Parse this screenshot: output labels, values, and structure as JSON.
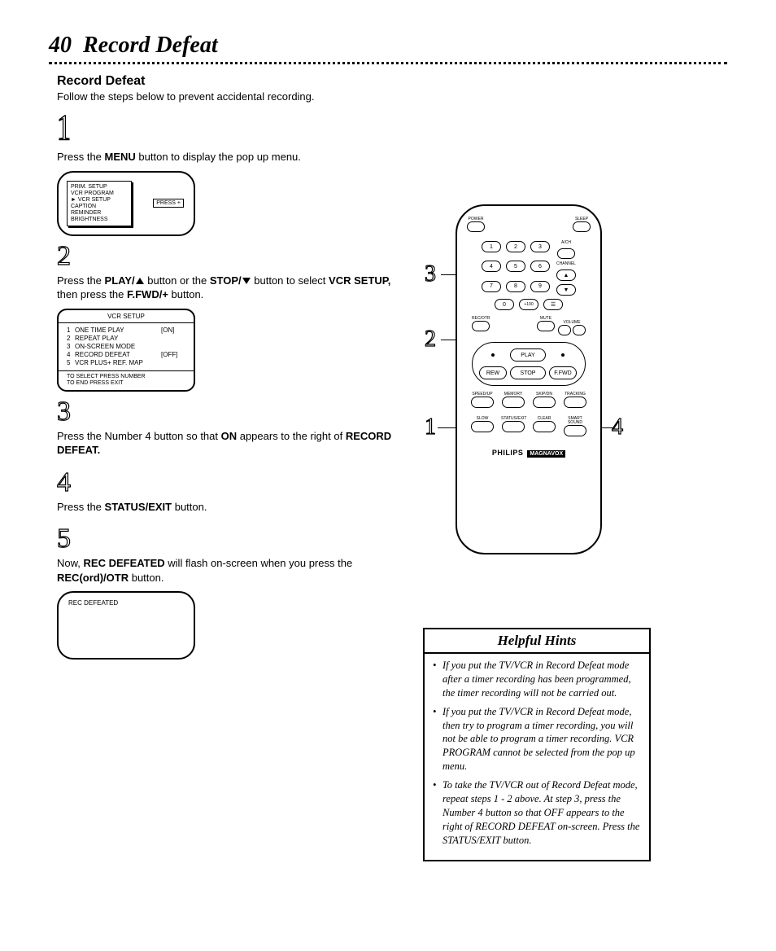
{
  "page": {
    "number": "40",
    "title": "Record Defeat",
    "subheading": "Record Defeat",
    "intro": "Follow the steps below to prevent accidental recording."
  },
  "steps": {
    "s1": {
      "num": "1",
      "text_a": "Press the ",
      "b1": "MENU",
      "text_b": " button to display the pop up menu."
    },
    "s2": {
      "num": "2",
      "t1": "Press the ",
      "b1": "PLAY/",
      "t2": " button or the ",
      "b2": "STOP/",
      "t3": " button to select ",
      "b3": "VCR SETUP,",
      "t4": " then press the ",
      "b4": "F.FWD/+",
      "t5": " button."
    },
    "s3": {
      "num": "3",
      "t1": "Press the Number 4 button so that ",
      "b1": "ON",
      "t2": " appears to the right of ",
      "b2": "RECORD DEFEAT."
    },
    "s4": {
      "num": "4",
      "t1": "Press the ",
      "b1": "STATUS/EXIT",
      "t2": " button."
    },
    "s5": {
      "num": "5",
      "t1": "Now, ",
      "b1": "REC DEFEATED",
      "t2": " will flash on-screen when you press the ",
      "b2": "REC(ord)/OTR",
      "t3": " button."
    }
  },
  "screen1": {
    "items": [
      "PRIM. SETUP",
      "VCR PROGRAM",
      "VCR SETUP",
      "CAPTION",
      "REMINDER",
      "BRIGHTNESS"
    ],
    "pointer_row": 2,
    "button": "PRESS +"
  },
  "screen2": {
    "title": "VCR SETUP",
    "rows": [
      {
        "n": "1",
        "label": "ONE TIME PLAY",
        "val": "[ON]"
      },
      {
        "n": "2",
        "label": "REPEAT PLAY",
        "val": ""
      },
      {
        "n": "3",
        "label": "ON-SCREEN MODE",
        "val": ""
      },
      {
        "n": "4",
        "label": "RECORD DEFEAT",
        "val": "[OFF]"
      },
      {
        "n": "5",
        "label": "VCR PLUS+ REF. MAP",
        "val": ""
      }
    ],
    "foot1": "TO SELECT PRESS NUMBER",
    "foot2": "TO END PRESS EXIT"
  },
  "screen3": {
    "text": "REC DEFEATED"
  },
  "remote": {
    "row1_left": "POWER",
    "row1_right": "SLEEP",
    "nums": [
      "1",
      "2",
      "3",
      "4",
      "5",
      "6",
      "7",
      "8",
      "9",
      "0",
      "+100"
    ],
    "side_top": "A/CH",
    "side_ch": "CHANNEL",
    "vol_left": "MUTE",
    "vol_right": "VOLUME",
    "rec": "REC/OTR",
    "play": "PLAY",
    "rew": "REW",
    "ffwd": "F.FWD",
    "stop": "STOP",
    "row_b": [
      "SPEED/UP",
      "MEMORY",
      "SKIP/DN",
      "TRACKING"
    ],
    "row_c": [
      "SLOW",
      "STATUS/EXIT",
      "CLEAR",
      "SMART SOUND"
    ],
    "brand": "PHILIPS",
    "brand_box": "MAGNAVOX",
    "callouts": {
      "c1": "1",
      "c2": "2",
      "c3": "3",
      "c4": "4"
    }
  },
  "hints": {
    "title": "Helpful Hints",
    "items": [
      "If you put the TV/VCR in Record Defeat mode after a timer recording has been programmed, the timer recording will not be carried out.",
      "If you put the TV/VCR in Record Defeat mode, then try to program a timer recording, you will not be able to program a timer recording. VCR PROGRAM cannot be selected from the pop up menu.",
      "To take the TV/VCR out of Record Defeat mode, repeat steps 1 - 2 above. At step 3, press the Number 4 button so that OFF appears to the right of RECORD DEFEAT on-screen. Press the STATUS/EXIT button."
    ]
  }
}
